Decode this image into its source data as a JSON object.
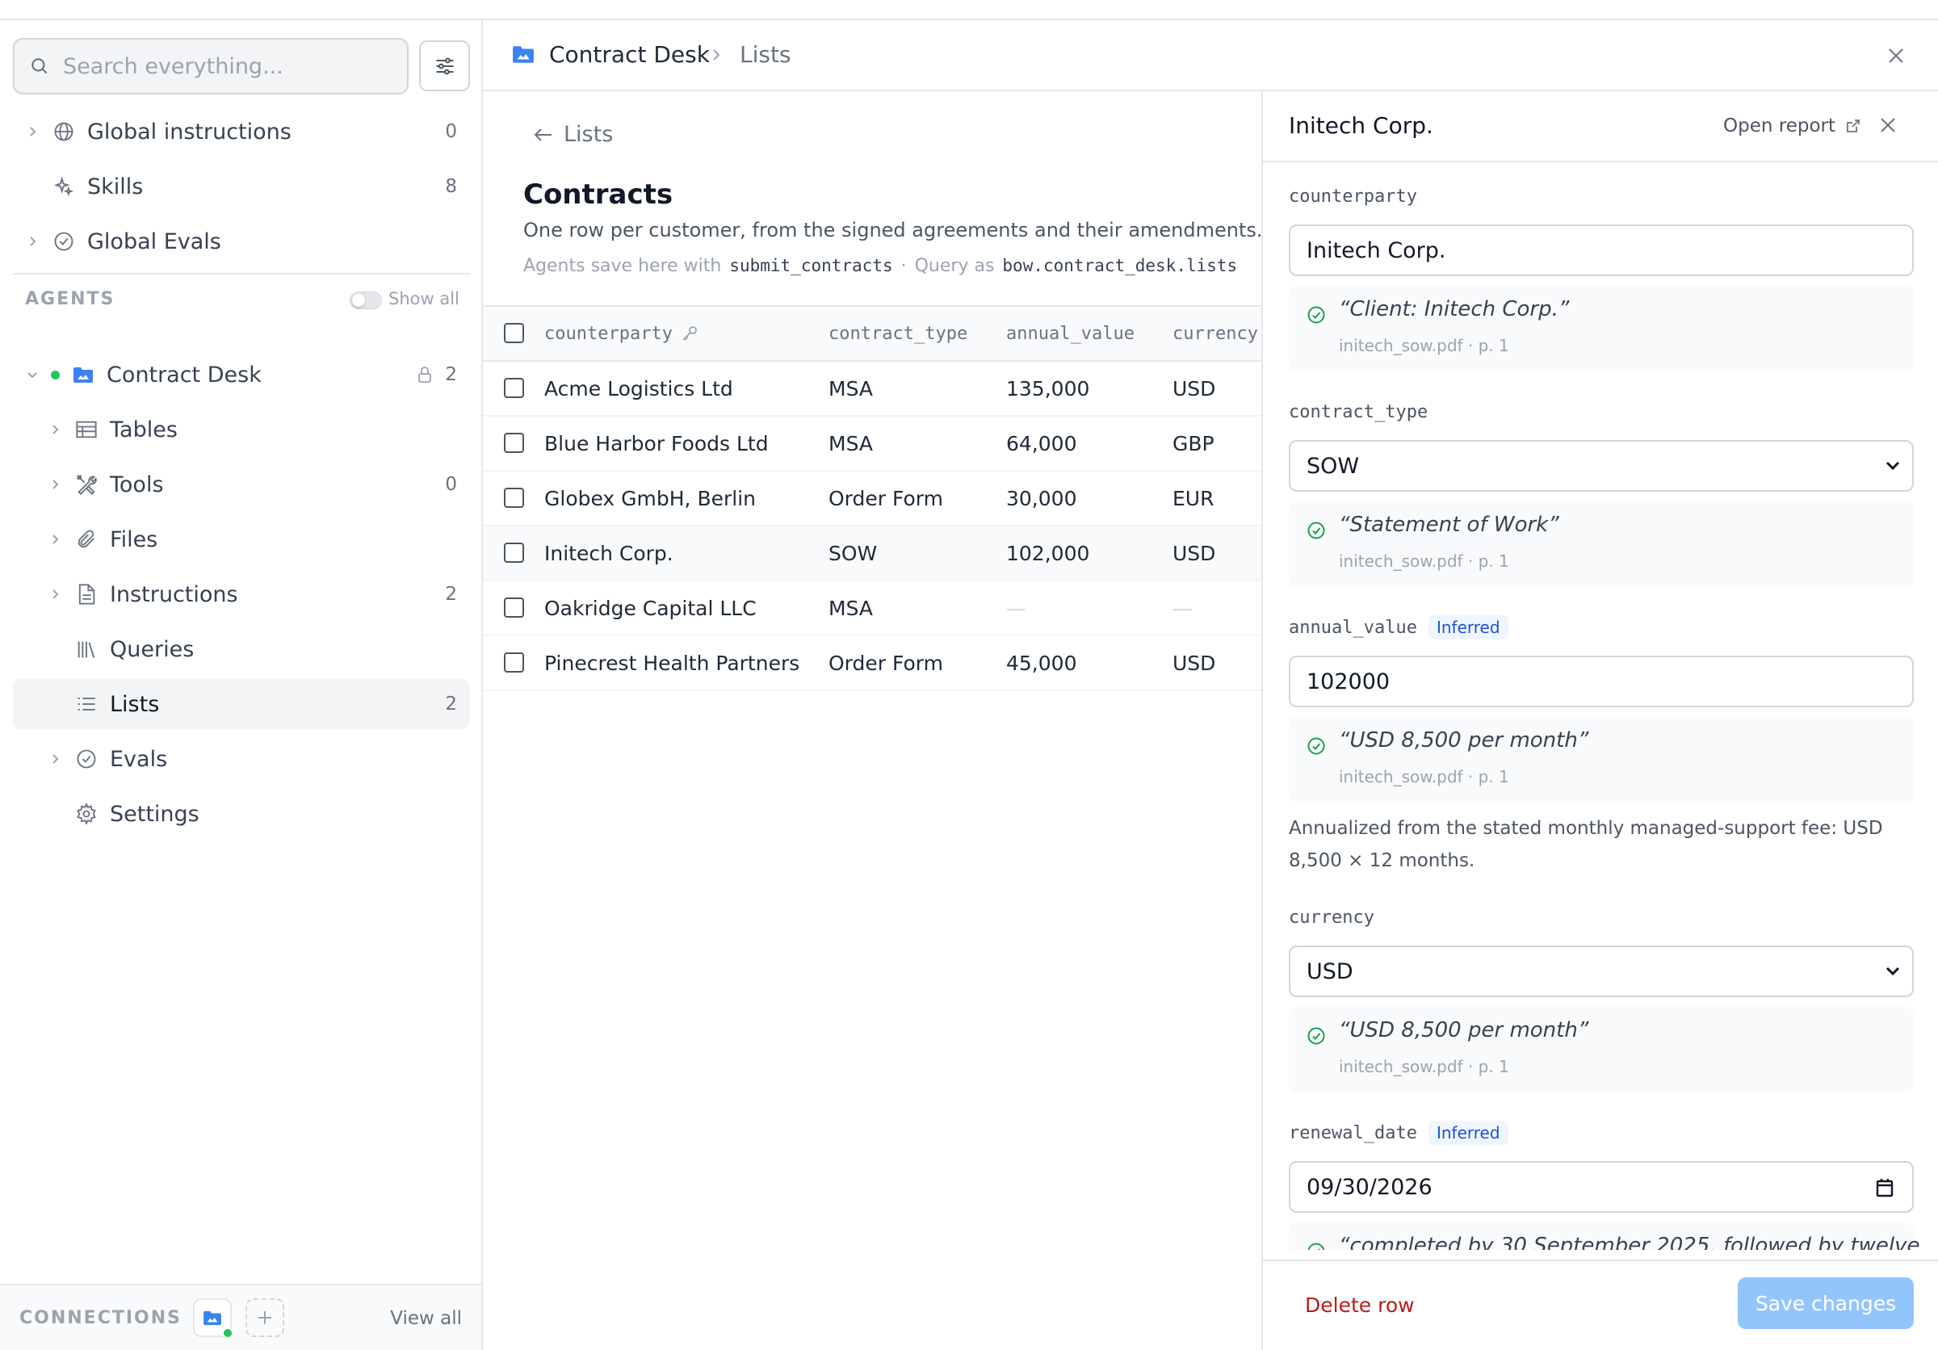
{
  "sidebar": {
    "search_placeholder": "Search everything...",
    "items": [
      {
        "label": "Global instructions",
        "count": "0"
      },
      {
        "label": "Skills",
        "count": "8"
      },
      {
        "label": "Global Evals",
        "count": ""
      }
    ],
    "agents_label": "AGENTS",
    "show_all_label": "Show all",
    "agent": {
      "label": "Contract Desk",
      "count": "2"
    },
    "agent_items": [
      {
        "label": "Tables",
        "count": ""
      },
      {
        "label": "Tools",
        "count": "0"
      },
      {
        "label": "Files",
        "count": ""
      },
      {
        "label": "Instructions",
        "count": "2"
      },
      {
        "label": "Queries",
        "count": ""
      },
      {
        "label": "Lists",
        "count": "2"
      },
      {
        "label": "Evals",
        "count": ""
      },
      {
        "label": "Settings",
        "count": ""
      }
    ],
    "connections_label": "CONNECTIONS",
    "view_all_label": "View all"
  },
  "header": {
    "breadcrumb": [
      "Contract Desk",
      "Lists"
    ]
  },
  "main": {
    "back_label": "Lists",
    "title": "Contracts",
    "description": "One row per customer, from the signed agreements and their amendments.",
    "meta_prefix": "Agents save here with",
    "meta_tool": "submit_contracts",
    "meta_sep": "·",
    "meta_query": "Query as",
    "meta_table": "bow.contract_desk.lists",
    "columns": [
      "counterparty",
      "contract_type",
      "annual_value",
      "currency"
    ],
    "rows": [
      {
        "counterparty": "Acme Logistics Ltd",
        "contract_type": "MSA",
        "annual_value": "135,000",
        "currency": "USD"
      },
      {
        "counterparty": "Blue Harbor Foods Ltd",
        "contract_type": "MSA",
        "annual_value": "64,000",
        "currency": "GBP"
      },
      {
        "counterparty": "Globex GmbH, Berlin",
        "contract_type": "Order Form",
        "annual_value": "30,000",
        "currency": "EUR"
      },
      {
        "counterparty": "Initech Corp.",
        "contract_type": "SOW",
        "annual_value": "102,000",
        "currency": "USD"
      },
      {
        "counterparty": "Oakridge Capital LLC",
        "contract_type": "MSA",
        "annual_value": "—",
        "currency": "—"
      },
      {
        "counterparty": "Pinecrest Health Partners",
        "contract_type": "Order Form",
        "annual_value": "45,000",
        "currency": "USD"
      }
    ]
  },
  "drawer": {
    "title": "Initech Corp.",
    "open_report": "Open report",
    "fields": [
      {
        "label": "counterparty",
        "badge": "",
        "value": "Initech Corp.",
        "quote": "“Client: Initech Corp.”",
        "source": "initech_sow.pdf · p. 1"
      },
      {
        "label": "contract_type",
        "badge": "",
        "value": "SOW",
        "quote": "“Statement of Work”",
        "source": "initech_sow.pdf · p. 1"
      },
      {
        "label": "annual_value",
        "badge": "Inferred",
        "value": "102000",
        "quote": "“USD 8,500 per month”",
        "source": "initech_sow.pdf · p. 1",
        "note": "Annualized from the stated monthly managed-support fee: USD 8,500 × 12 months."
      },
      {
        "label": "currency",
        "badge": "",
        "value": "USD",
        "quote": "“USD 8,500 per month”",
        "source": "initech_sow.pdf · p. 1"
      },
      {
        "label": "renewal_date",
        "badge": "Inferred",
        "value": "09/30/2026",
        "quote": "“completed by 30 September 2025, followed by twelve"
      }
    ],
    "delete_label": "Delete row",
    "save_label": "Save changes"
  },
  "colors": {
    "accent": "#3b82f6",
    "status_green": "#22c55e",
    "danger": "#b91c1c",
    "badge_blue": "#1d4ed8"
  }
}
